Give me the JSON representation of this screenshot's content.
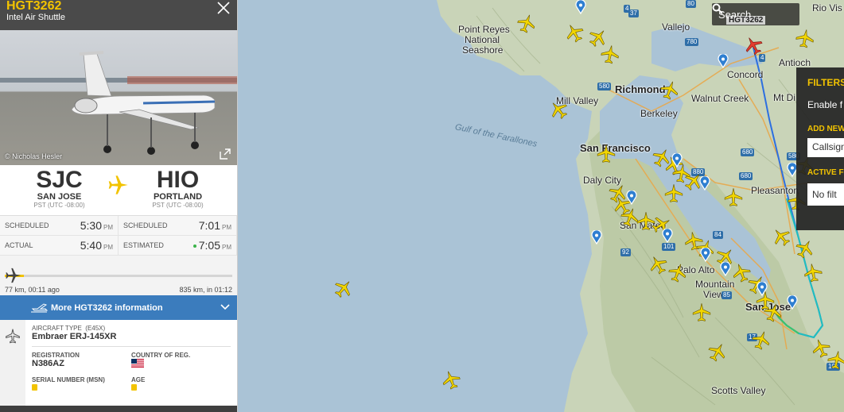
{
  "panel": {
    "callsign": "HGT3262",
    "airline": "Intel Air Shuttle",
    "photo_credit": "© Nicholas Hesler",
    "origin": {
      "iata": "SJC",
      "city": "SAN JOSE",
      "tz": "PST (UTC -08:00)"
    },
    "destination": {
      "iata": "HIO",
      "city": "PORTLAND",
      "tz": "PST (UTC -08:00)"
    },
    "times": {
      "scheduled_label": "SCHEDULED",
      "actual_label": "ACTUAL",
      "estimated_label": "ESTIMATED",
      "dep_scheduled": "5:30",
      "dep_actual": "5:40",
      "arr_scheduled": "7:01",
      "arr_estimated": "7:05",
      "pm": "PM"
    },
    "progress": {
      "fraction": 0.085,
      "left": "77 km, 00:11 ago",
      "right": "835 km, in 01:12"
    },
    "more_label": "More HGT3262 information",
    "aircraft_type_label": "AIRCRAFT TYPE",
    "aircraft_type_code": "(E45X)",
    "aircraft_type": "Embraer ERJ-145XR",
    "registration_label": "REGISTRATION",
    "registration": "N386AZ",
    "country_label": "COUNTRY OF REG.",
    "serial_label": "SERIAL NUMBER (MSN)",
    "age_label": "AGE"
  },
  "map": {
    "search_label": "Search",
    "callsign_tag": "HGT3262",
    "labels": {
      "point_reyes": "Point Reyes",
      "national": "National",
      "seashore": "Seashore",
      "vallejo": "Vallejo",
      "antioch": "Antioch",
      "concord": "Concord",
      "richmond": "Richmond",
      "walnut_creek": "Walnut Creek",
      "mill_valley": "Mill Valley",
      "berkeley": "Berkeley",
      "gulf": "Gulf of the Farallones",
      "san_francisco": "San Francisco",
      "daly_city": "Daly City",
      "pleasanton": "Pleasanton",
      "san_mateo": "San Mateo",
      "palo_alto": "Palo Alto",
      "mountain": "Mountain",
      "view": "View",
      "san_jose": "San Jose",
      "scotts_valley": "Scotts Valley",
      "rio_vista": "Rio Vis",
      "mt_diablo": "Mt Di"
    },
    "highways": [
      "37",
      "780",
      "80",
      "4",
      "580",
      "680",
      "680",
      "580",
      "880",
      "92",
      "101",
      "84",
      "85",
      "17",
      "101",
      "4"
    ]
  },
  "filters": {
    "title": "FILTERS",
    "enable": "Enable f",
    "add_new": "ADD NEW",
    "callsign_placeholder": "Callsign",
    "active": "ACTIVE F",
    "no_filters": "No filt"
  },
  "colors": {
    "accent": "#f2c300",
    "info_bar": "#3b7cbd",
    "header": "#4a4a4a"
  }
}
